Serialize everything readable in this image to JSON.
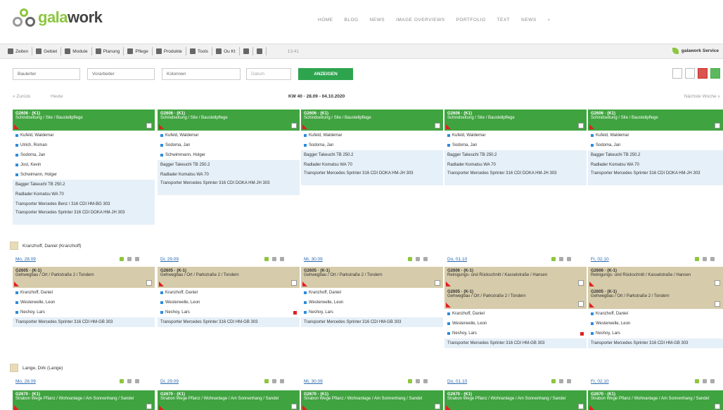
{
  "header": {
    "logo_text_a": "gala",
    "logo_text_b": "work",
    "nav": [
      "HOME",
      "BLOG",
      "NEWS",
      "IMAGE OVERVIEWS",
      "PORTFOLIO",
      "TEXT",
      "NEWS"
    ]
  },
  "toolbar": {
    "items": [
      "Zeiten",
      "Gebiet",
      "Module",
      "Planung",
      "Pflege",
      "Produkte",
      "Tools",
      "Ou Kt",
      "",
      ""
    ],
    "time": "13:41",
    "user": "galawork Service"
  },
  "filters": {
    "f1": "Baulerter",
    "f2": "Vorarbeiter",
    "f3": "Kolonnen",
    "f4": "Datum",
    "submit": "ANZEIGEN"
  },
  "weeknav": {
    "back": "« Zurück",
    "today": "Heute",
    "week": "KW 40 · 28.09 - 04.10.2020",
    "next": "Nächste Woche »"
  },
  "week1": {
    "cards": [
      {
        "t1": "G2606 · (K1)",
        "t2": "Schindseitung / Site / Baustellpflege",
        "people": [
          "Kufeld, Waldemar",
          "Ulrich, Roman",
          "Sodoma, Jan",
          "Jost, Kevin",
          "Schwimann, Holger"
        ],
        "equip": [
          "Bagger Takeuchi TB 250.2",
          "Radlader Komatsu WA 70",
          "Transporter Mercedes Benz / 316 CDI HM-BG 303",
          "Transporter Mercedes Sprinter 316 CDI DOKA HM-JH 303"
        ]
      },
      {
        "t1": "G2606 · (K1)",
        "t2": "Schindseitung / Site / Baustellpflege",
        "people": [
          "Kufeld, Waldemar",
          "Sodoma, Jan",
          "Schwimmann, Holger"
        ],
        "equip": [
          "Bagger Takeuchi TB 250.2",
          "Radlader Komatsu WA 70",
          "Transporter Mercedes Sprinter 316 CDI DOKA HM-JH 303"
        ]
      },
      {
        "t1": "G2606 · (K1)",
        "t2": "Schindseitung / Site / Baustellpflege",
        "people": [
          "Kufeld, Waldemar",
          "Sodoma, Jan"
        ],
        "equip": [
          "Bagger Takeuchi TB 250.2",
          "Radlader Komatsu WA 70",
          "Transporter Mercedes Sprinter 316 CDI DOKA HM-JH 303"
        ]
      },
      {
        "t1": "G2606 · (K1)",
        "t2": "Schindseitung / Site / Baustellpflege",
        "people": [
          "Kufeld, Waldemar",
          "Sodoma, Jan"
        ],
        "equip": [
          "Bagger Takeuchi TB 250.2",
          "Radlader Komatsu WA 70",
          "Transporter Mercedes Sprinter 316 CDI DOKA HM-JH 303"
        ]
      },
      {
        "t1": "G2606 · (K1)",
        "t2": "Schindseitung / Site / Baustellpflege",
        "people": [
          "Kufeld, Waldemar",
          "Sodoma, Jan"
        ],
        "equip": [
          "Bagger Takeuchi TB 250.2",
          "Radlader Komatsu WA 70",
          "Transporter Mercedes Sprinter 316 CDI DOKA HM-JH 303"
        ]
      }
    ]
  },
  "group1": {
    "name": "Kranzhoff, Daniel (Kranzhoff)",
    "days": [
      "Mo, 28.09",
      "Di, 29.09",
      "Mi, 30.09",
      "Do, 01.10",
      "Fr, 02.10"
    ],
    "cards": [
      {
        "t1": "G2605 · (K-1)",
        "t2": "Gehwegbau / Ort / Parkstraße 2 / Tondern",
        "people": [
          "Kranzhoff, Daniel",
          "Westerwelle, Leon",
          "Neshoy, Lars"
        ],
        "equip": [
          "Transporter Mercedes Sprinter 316 CDI HM-GB 303"
        ]
      },
      {
        "t1": "G2605 · (K-1)",
        "t2": "Gehwegbau / Ort / Parkstraße 2 / Tondern",
        "people": [
          "Kranzhoff, Daniel",
          "Westerwelle, Leon",
          "Neshoy, Lars"
        ],
        "equip": [
          "Transporter Mercedes Sprinter 316 CDI HM-GB 303"
        ]
      },
      {
        "t1": "G2605 · (K-1)",
        "t2": "Gehwegbau / Ort / Parkstraße 2 / Tondern",
        "people": [
          "Kranzhoff, Daniel",
          "Westerwelle, Leon",
          "Neshoy, Lars"
        ],
        "equip": [
          "Transporter Mercedes Sprinter 316 CDI HM-GB 303"
        ]
      },
      {
        "t1": "G2606 · (K-1)",
        "t2": "Reinigungs- und Rückschnitt / Kasselstraße / Hansen",
        "t3": "G2605 · (K-1)",
        "t4": "Gehwegbau / Ort / Parkstraße 2 / Tondern",
        "people": [
          "Kranzhoff, Daniel",
          "Westerwelle, Leon",
          "Neshoy, Lars"
        ],
        "equip": [
          "Transporter Mercedes Sprinter 316 CDI HM-GB 303"
        ]
      },
      {
        "t1": "G2606 · (K-1)",
        "t2": "Reinigungs- und Rückschnitt / Kasselstraße / Hansen",
        "t3": "G2605 · (K-1)",
        "t4": "Gehwegbau / Ort / Parkstraße 2 / Tondern",
        "people": [
          "Kranzhoff, Daniel",
          "Westerwelle, Leon",
          "Neshoy, Lars"
        ],
        "equip": [
          "Transporter Mercedes Sprinter 316 CDI HM-GB 303"
        ]
      }
    ]
  },
  "group2": {
    "name": "Lange, Dirk (Lange)",
    "days": [
      "Mo, 28.09",
      "Di, 29.09",
      "Mi, 30.09",
      "Do, 01.10",
      "Fr, 02.10"
    ],
    "card_t1": "G2670 · (K1)",
    "card_t2": "Strabon Wege Pflanz / Wohnanlage / Am Sonnenhang / Sandel"
  }
}
